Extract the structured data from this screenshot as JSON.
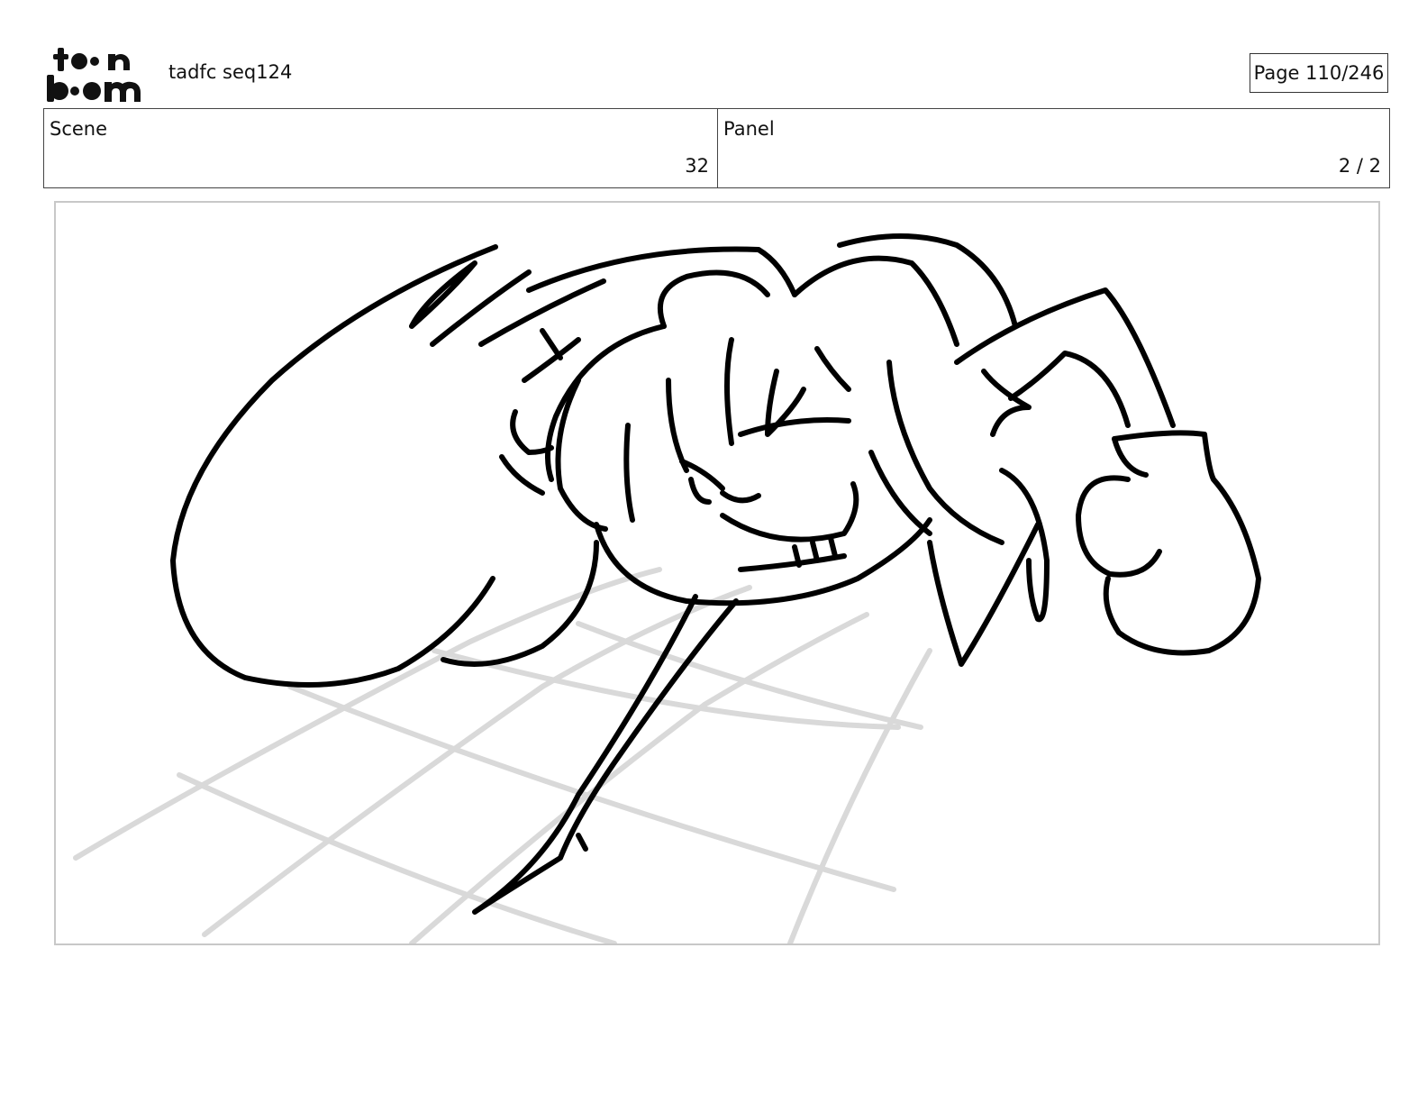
{
  "header": {
    "logo_top": "to●n",
    "logo_bottom": "b●●m",
    "project_title": "tadfc seq124",
    "page_label": "Page 110/246"
  },
  "info": {
    "scene_label": "Scene",
    "scene_value": "32",
    "panel_label": "Panel",
    "panel_value": "2 / 2"
  },
  "colors": {
    "line": "#000000",
    "grid": "#d9d9d9",
    "frame_border": "#c8c8c8"
  }
}
